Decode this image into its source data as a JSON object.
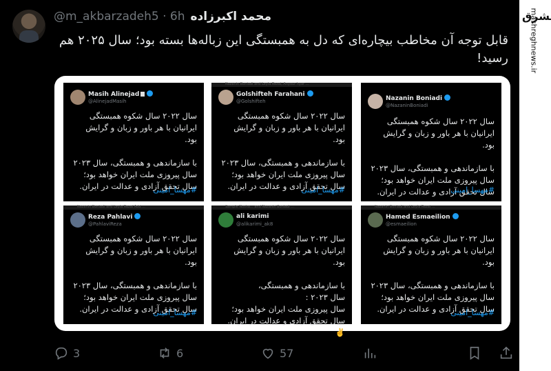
{
  "tweet": {
    "author_name": "محمد اکبرزاده",
    "handle": "@m_akbarzadeh5 · 6h",
    "text": "قابل توجه آن مخاطب بیچاره‌ای که دل به همبستگی این زباله‌ها بسته بود؛ سال ۲۰۲۵ هم رسید!"
  },
  "watermark": {
    "logo": "مشرق",
    "url": "mashreghnews.ir"
  },
  "cards": [
    {
      "name": "Masih Alinejad",
      "handle": "@AlinejadMasih",
      "strip": "",
      "body": "سال ۲۰۲۲ سال شکوه همبستگی ایرانیان با هر باور و زبان و گرایش بود.\n\nبا سازماندهی و همبستگی، سال ۲۰۲۳ سال پیروزی ملت ایران خواهد بود؛ سال تحقق آزادی و عدالت در ایران.",
      "tag": "#مهسا_امینی"
    },
    {
      "name": "Golshifteh Farahani",
      "handle": "@Golshifteh",
      "strip": "Nazanin Boniadi and Leyla Rezai, Anyour hyar ...",
      "body": "سال ۲۰۲۲ سال شکوه همبستگی ایرانیان با هر باور و زبان و گرایش بود.\n\nبا سازماندهی و همبستگی، سال ۲۰۲۳ سال پیروزی ملت ایران خواهد بود؛ سال تحقق آزادی و عدالت در ایران.",
      "tag": "#مهسا_امینی"
    },
    {
      "name": "Nazanin Boniadi",
      "handle": "@NazaninBoniadi",
      "strip": "",
      "body": "سال ۲۰۲۲ سال شکوه همبستگی ایرانیان با هر باور و زبان و گرایش بود.\n\nبا سازماندهی و همبستگی، سال ۲۰۲۳ سال پیروزی ملت ایران خواهد بود؛ سال تحقق آزادی و عدالت در ایران.",
      "tag": "#مهسا_امینی"
    },
    {
      "name": "Reza Pahlavi",
      "handle": "@PahlaviReza",
      "strip": "Nazanin Boniadi and Leyla Rezai Add ...",
      "body": "سال ۲۰۲۲ سال شکوه همبستگی ایرانیان با هر باور و زبان و گرایش بود.\n\nبا سازماندهی و همبستگی، سال ۲۰۲۳ سال پیروزی ملت ایران خواهد بود؛ سال تحقق آزادی و عدالت در ایران.",
      "tag": "#مهسا_امینی"
    },
    {
      "name": "ali karimi",
      "handle": "@alikarimi_ak8",
      "strip": "Sample Nosha... and Nazanin Boniadi ...",
      "body": "سال ۲۰۲۲ سال شکوه همبستگی ایرانیان با هر باور و زبان و گرایش بود.\n\nبا سازماندهی و همبستگی،\nسال ۲۰۲۳ :\nسال پیروزی ملت ایران خواهد بود؛\nسال تحقق آزادی و عدالت در ایران. ✌️",
      "tag": ""
    },
    {
      "name": "Hamed Esmaeilion",
      "handle": "@esmaeilion",
      "strip": "Nazanin Boniadi and Leyla Rezai ...",
      "body": "سال ۲۰۲۲ سال شکوه همبستگی ایرانیان با هر باور و زبان و گرایش بود.\n\nبا سازماندهی و همبستگی، سال ۲۰۲۳ سال پیروزی ملت ایران خواهد بود؛ سال تحقق آزادی و عدالت در ایران.",
      "tag": "#مهسا_امینی"
    }
  ],
  "actions": {
    "reply_count": "3",
    "retweet_count": "6",
    "like_count": "57"
  },
  "icons": [
    "reply-icon",
    "retweet-icon",
    "like-icon",
    "views-icon",
    "bookmark-icon",
    "share-icon"
  ]
}
